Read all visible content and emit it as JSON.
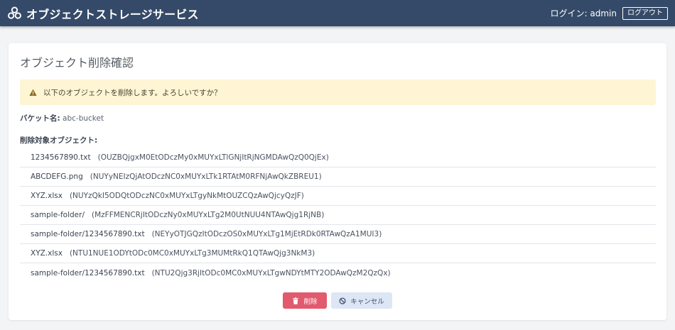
{
  "header": {
    "app_title": "オブジェクトストレージサービス",
    "login_label": "ログイン: admin",
    "logout_label": "ログアウト"
  },
  "page": {
    "title": "オブジェクト削除確認",
    "alert_text": "以下のオブジェクトを削除します。よろしいですか？",
    "bucket_label": "バケット名:",
    "bucket_value": "abc-bucket",
    "targets_label": "削除対象オブジェクト:"
  },
  "objects": [
    {
      "name": "1234567890.txt",
      "id": "(OUZBQjgxM0EtODczMy0xMUYxLTlGNjItRjNGMDAwQzQ0QjEx)"
    },
    {
      "name": "ABCDEFG.png",
      "id": "(NUYyNEIzQjAtODczNC0xMUYxLTk1RTAtM0RFNjAwQkZBREU1)"
    },
    {
      "name": "XYZ.xlsx",
      "id": "(NUYzQkI5ODQtODczNC0xMUYxLTgyNkMtOUZCQzAwQjcyQzJF)"
    },
    {
      "name": "sample-folder/",
      "id": "(MzFFMENCRjItODczNy0xMUYxLTg2M0UtNUU4NTAwQjg1RjNB)"
    },
    {
      "name": "sample-folder/1234567890.txt",
      "id": "(NEYyOTJGQzItODczOS0xMUYxLTg1MjEtRDk0RTAwQzA1MUI3)"
    },
    {
      "name": "XYZ.xlsx",
      "id": "(NTU1NUE1ODYtODc0MC0xMUYxLTg3MUMtRkQ1QTAwQjg3NkM3)"
    },
    {
      "name": "sample-folder/1234567890.txt",
      "id": "(NTU2Qjg3RjItODc0MC0xMUYxLTgwNDYtMTY2ODAwQzM2QzQx)"
    }
  ],
  "actions": {
    "delete_label": "削除",
    "cancel_label": "キャンセル"
  },
  "colors": {
    "header_bg": "#354a68",
    "alert_bg": "#fef5d4",
    "delete_btn": "#e15a6e",
    "cancel_btn": "#dce6f4"
  },
  "icons": {
    "brand": "cubes-icon",
    "alert": "warning-triangle-icon",
    "delete": "trash-icon",
    "cancel": "ban-icon"
  }
}
